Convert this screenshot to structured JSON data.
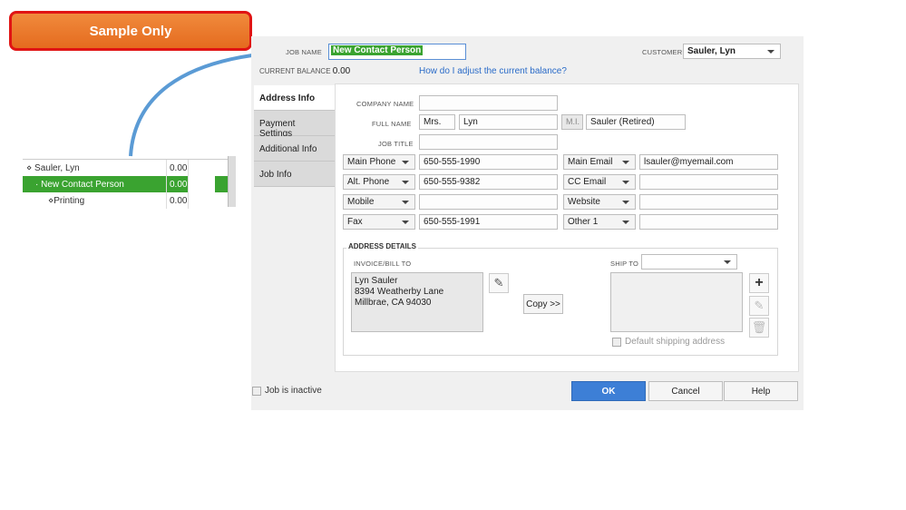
{
  "badge": {
    "text": "Sample Only"
  },
  "tree": {
    "rows": [
      {
        "name": "⋄ Sauler, Lyn",
        "balance": "0.00"
      },
      {
        "name": "· New Contact Person",
        "balance": "0.00"
      },
      {
        "name": "⋄Printing",
        "balance": "0.00"
      }
    ]
  },
  "dialog": {
    "job_name_label": "JOB NAME",
    "job_name_value": "New Contact Person",
    "customer_label": "CUSTOMER",
    "customer_value": "Sauler, Lyn",
    "current_balance_label": "CURRENT BALANCE",
    "current_balance_value": "0.00",
    "adjust_link": "How do I adjust the current balance?",
    "tabs": [
      "Address Info",
      "Payment Settings",
      "Additional Info",
      "Job Info"
    ],
    "company_name_label": "COMPANY NAME",
    "company_name_value": "",
    "full_name_label": "FULL NAME",
    "title_value": "Mrs.",
    "first_name_value": "Lyn",
    "mi_placeholder": "M.I.",
    "last_name_value": "Sauler (Retired)",
    "job_title_label": "JOB TITLE",
    "job_title_value": "",
    "phones": [
      {
        "type": "Main Phone",
        "value": "650-555-1990"
      },
      {
        "type": "Alt. Phone",
        "value": "650-555-9382"
      },
      {
        "type": "Mobile",
        "value": ""
      },
      {
        "type": "Fax",
        "value": "650-555-1991"
      }
    ],
    "contacts": [
      {
        "type": "Main Email",
        "value": "lsauler@myemail.com"
      },
      {
        "type": "CC Email",
        "value": ""
      },
      {
        "type": "Website",
        "value": ""
      },
      {
        "type": "Other 1",
        "value": ""
      }
    ],
    "address_details_label": "ADDRESS DETAILS",
    "bill_to_label": "INVOICE/BILL TO",
    "bill_to_lines": [
      "Lyn Sauler",
      "8394 Weatherby Lane",
      "Millbrae, CA 94030"
    ],
    "ship_to_label": "SHIP TO",
    "ship_to_value": "",
    "copy_button": "Copy >>",
    "default_shipping_label": "Default shipping address",
    "inactive_label": "Job is inactive",
    "ok_button": "OK",
    "cancel_button": "Cancel",
    "help_button": "Help"
  }
}
